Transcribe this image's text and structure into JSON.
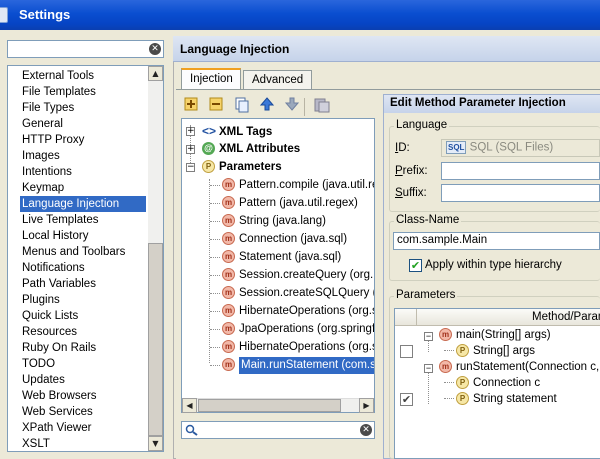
{
  "window": {
    "title": "Settings"
  },
  "left": {
    "search": {
      "value": "",
      "placeholder": ""
    },
    "items": [
      "External Tools",
      "File Templates",
      "File Types",
      "General",
      "HTTP Proxy",
      "Images",
      "Intentions",
      "Keymap",
      "Language Injection",
      "Live Templates",
      "Local History",
      "Menus and Toolbars",
      "Notifications",
      "Path Variables",
      "Plugins",
      "Quick Lists",
      "Resources",
      "Ruby On Rails",
      "TODO",
      "Updates",
      "Web Browsers",
      "Web Services",
      "XPath Viewer",
      "XSLT"
    ],
    "selected": "Language Injection"
  },
  "panel": {
    "title": "Language Injection",
    "tabs": [
      "Injection",
      "Advanced"
    ],
    "active_tab": "Injection",
    "toolbar": {
      "add_icon": "add-icon",
      "remove_icon": "remove-icon",
      "copy_icon": "copy-icon",
      "up_icon": "arrow-up-icon",
      "down_icon": "arrow-down-icon",
      "import_icon": "import-icon"
    },
    "tree": {
      "groups": [
        {
          "label": "XML Tags",
          "expanded": false
        },
        {
          "label": "XML Attributes",
          "expanded": false
        },
        {
          "label": "Parameters",
          "expanded": true
        }
      ],
      "parameters": [
        "Pattern.compile (java.util.re",
        "Pattern (java.util.regex)",
        "String (java.lang)",
        "Connection (java.sql)",
        "Statement (java.sql)",
        "Session.createQuery (org.h",
        "Session.createSQLQuery (org.",
        "HibernateOperations (org.s",
        "JpaOperations (org.springfr",
        "HibernateOperations (org.s",
        "Main.runStatement (com.sa"
      ],
      "selected": "Main.runStatement (com.sa"
    }
  },
  "edit": {
    "title": "Edit Method Parameter Injection",
    "language_group": "Language",
    "id_label": "ID:",
    "id_value": "SQL",
    "id_hint": "(SQL Files)",
    "sql_badge": "SQL",
    "prefix_label": "Prefix:",
    "prefix_value": "",
    "suffix_label": "Suffix:",
    "suffix_value": "",
    "classname_group": "Class-Name",
    "classname_value": "com.sample.Main",
    "apply_hierarchy_label": "Apply within type hierarchy",
    "apply_hierarchy_checked": true,
    "params_group": "Parameters",
    "params_header": "Method/Param",
    "params_rows": [
      {
        "text": "main(String[] args)",
        "kind": "m",
        "level": 0,
        "checkbox": null
      },
      {
        "text": "String[] args",
        "kind": "p",
        "level": 1,
        "checkbox": false
      },
      {
        "text": "runStatement(Connection c, S",
        "kind": "m",
        "level": 0,
        "checkbox": null
      },
      {
        "text": "Connection c",
        "kind": "p",
        "level": 1,
        "checkbox": null
      },
      {
        "text": "String statement",
        "kind": "p",
        "level": 1,
        "checkbox": true
      }
    ]
  }
}
